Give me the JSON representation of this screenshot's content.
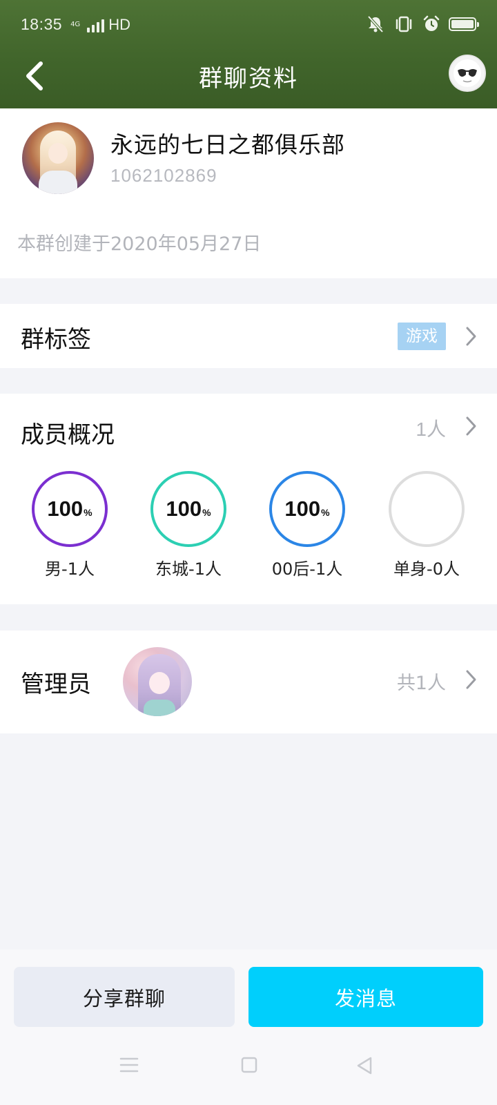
{
  "status_bar": {
    "time": "18:35",
    "network": "4G",
    "hd": "HD"
  },
  "nav": {
    "title": "群聊资料"
  },
  "group": {
    "name": "永远的七日之都俱乐部",
    "id": "1062102869",
    "created": "本群创建于2020年05月27日"
  },
  "tag_row": {
    "label": "群标签",
    "tag": "游戏"
  },
  "members": {
    "label": "成员概况",
    "count": "1人",
    "stats": [
      {
        "value": "100",
        "unit": "%",
        "label": "男-1人",
        "color": "#7b2fd0",
        "percent": 100
      },
      {
        "value": "100",
        "unit": "%",
        "label": "东城-1人",
        "color": "#2ccfb3",
        "percent": 100
      },
      {
        "value": "100",
        "unit": "%",
        "label": "00后-1人",
        "color": "#2b86e6",
        "percent": 100
      },
      {
        "value": "",
        "unit": "",
        "label": "单身-0人",
        "color": "#dddddd",
        "percent": 0
      }
    ]
  },
  "admins": {
    "label": "管理员",
    "count": "共1人"
  },
  "actions": {
    "share": "分享群聊",
    "send": "发消息"
  },
  "colors": {
    "header_green": "#41652b",
    "tag_blue": "#a6d2f3",
    "send_button": "#00cffc"
  }
}
